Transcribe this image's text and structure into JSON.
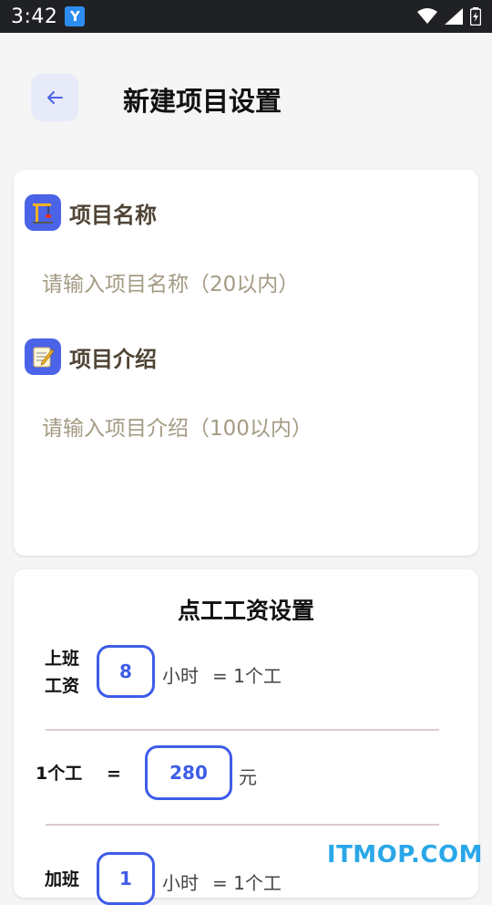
{
  "status_bar": {
    "time": "3:42",
    "app_badge": "Y"
  },
  "header": {
    "title": "新建项目设置"
  },
  "project": {
    "name_label": "项目名称",
    "name_placeholder": "请输入项目名称（20以内）",
    "intro_label": "项目介绍",
    "intro_placeholder": "请输入项目介绍（100以内）"
  },
  "wage": {
    "title": "点工工资设置",
    "work_label_1": "上班",
    "work_label_2": "工资",
    "hours_value": "8",
    "hours_unit": "小时",
    "hours_equals": "= 1个工",
    "unit_label": "1个工",
    "unit_equals": "=",
    "wage_value": "280",
    "wage_unit": "元",
    "overtime_label": "加班",
    "overtime_value": "1",
    "overtime_unit": "小时",
    "overtime_equals": "= 1个工"
  },
  "watermark": "ITMOP.COM",
  "colors": {
    "accent": "#3f5ce8",
    "icon_bg": "#4a63e7",
    "back_bg": "#e7eaf8"
  },
  "icons": [
    "arrow-left-icon",
    "crane-icon",
    "memo-icon",
    "wifi-icon",
    "signal-icon",
    "battery-icon"
  ]
}
